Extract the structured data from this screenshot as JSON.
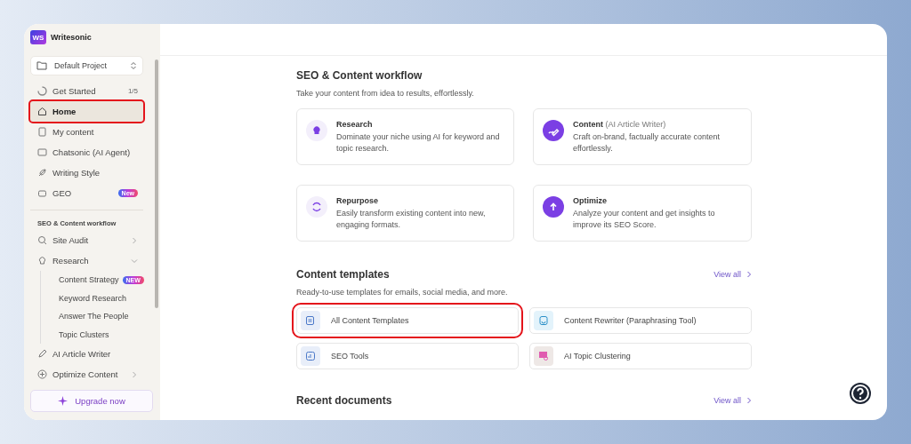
{
  "brand": {
    "name": "Writesonic",
    "logo": "WS"
  },
  "project": {
    "label": "Default Project"
  },
  "nav": [
    {
      "kind": "progress",
      "label": "Get Started",
      "count": "1/5",
      "highlighted": false
    },
    {
      "kind": "item",
      "label": "Home",
      "highlighted": true
    },
    {
      "kind": "item",
      "label": "My content",
      "highlighted": false
    },
    {
      "kind": "item",
      "label": "Chatsonic (AI Agent)",
      "highlighted": false
    },
    {
      "kind": "item",
      "label": "Writing Style",
      "highlighted": false
    },
    {
      "kind": "item",
      "label": "GEO",
      "badge": "New",
      "highlighted": false
    }
  ],
  "workflow_nav": {
    "title": "SEO & Content workflow",
    "items": [
      {
        "label": "Site Audit",
        "expanded": false
      },
      {
        "label": "Research",
        "expanded": true,
        "children": [
          {
            "label": "Content Strategy",
            "badge": "NEW"
          },
          {
            "label": "Keyword Research"
          },
          {
            "label": "Answer The People"
          },
          {
            "label": "Topic Clusters"
          }
        ]
      },
      {
        "label": "AI Article Writer"
      },
      {
        "label": "Optimize Content",
        "expanded": false
      }
    ]
  },
  "upgrade_button": "Upgrade now",
  "workflow": {
    "title": "SEO & Content workflow",
    "subtitle": "Take your content from idea to results, effortlessly.",
    "cards": [
      {
        "title": "Research",
        "description": "Dominate your niche using AI for keyword and topic research.",
        "active": false
      },
      {
        "title": "Content",
        "title_note": "(AI Article Writer)",
        "description": "Craft on-brand, factually accurate content effortlessly.",
        "active": true
      },
      {
        "title": "Repurpose",
        "description": "Easily transform existing content into new, engaging formats.",
        "active": false
      },
      {
        "title": "Optimize",
        "description": "Analyze your content and get insights to improve its SEO Score.",
        "active": true
      }
    ]
  },
  "templates": {
    "title": "Content templates",
    "view_all": "View all",
    "subtitle": "Ready-to-use templates for emails, social media, and more.",
    "items": [
      {
        "label": "All Content Templates",
        "highlighted": true
      },
      {
        "label": "Content Rewriter (Paraphrasing Tool)",
        "highlighted": false
      },
      {
        "label": "SEO Tools",
        "highlighted": false
      },
      {
        "label": "AI Topic Clustering",
        "highlighted": false
      }
    ]
  },
  "recent": {
    "title": "Recent documents",
    "view_all": "View all"
  }
}
